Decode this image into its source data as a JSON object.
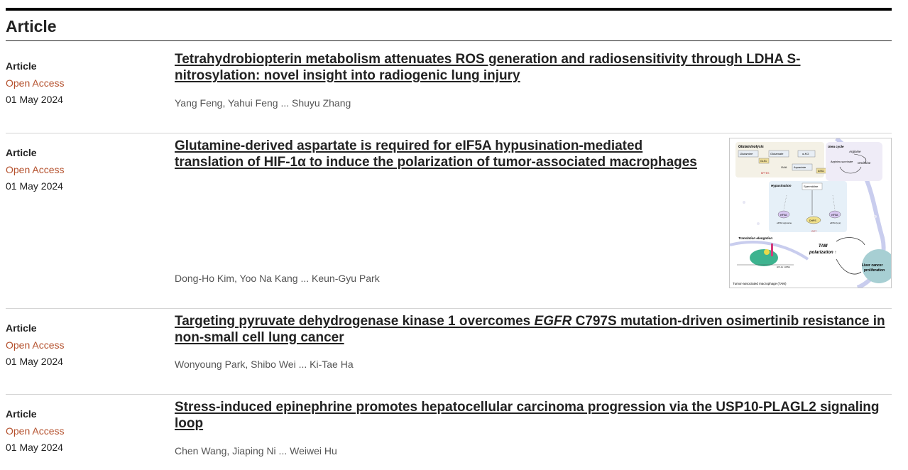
{
  "section": {
    "heading": "Article"
  },
  "articles": [
    {
      "type": "Article",
      "access": "Open Access",
      "date": "01 May 2024",
      "title_line1": "Tetrahydrobiopterin metabolism attenuates ROS generation and radiosensitivity through LDHA S-",
      "title_line2": "nitrosylation: novel insight into radiogenic lung injury",
      "authors": "Yang Feng, Yahui Feng ... Shuyu Zhang"
    },
    {
      "type": "Article",
      "access": "Open Access",
      "date": "01 May 2024",
      "title_line1": "Glutamine-derived aspartate is required for eIF5A hypusination-mediated",
      "title_line2": "translation of HIF-1α to induce the polarization of tumor-associated macrophages",
      "authors": "Dong-Ho Kim, Yoo Na Kang ... Keun-Gyu Park",
      "figure": {
        "glutaminolysis": "Glutaminolysis",
        "urea_cycle": "Urea cycle",
        "glutamine": "Glutamine",
        "glutamate": "Glutamate",
        "akg": "α-KG",
        "gls1": "GLS1",
        "oaa": "OAA",
        "aspartate": "Aspartate",
        "ass1": "ASS1",
        "bptes": "BPTES",
        "arginine": "Arginine",
        "arg_succ": "Arginino-succinate",
        "ornithine": "Ornithine",
        "hypusination": "Hypusination",
        "spermidine": "Spermidine",
        "eif5a": "eIF5A",
        "eif5a_hyp": "eIF5A Hypusine",
        "dhps": "DHPS",
        "eif5a_lys": "eIF5A (Lys)",
        "gc7": "GC7",
        "translation": "Translation elongation",
        "tam": "TAM",
        "polarization": "polarization ↑",
        "hif": "HIF-1α mRNA",
        "liver": "Liver cancer",
        "prolif": "proliferation",
        "footer": "Tumor-associated macrophage (TAM)"
      }
    },
    {
      "type": "Article",
      "access": "Open Access",
      "date": "01 May 2024",
      "title_line1_a": "Targeting pyruvate dehydrogenase kinase 1 overcomes ",
      "title_line1_em": "EGFR",
      "title_line1_b": " C797S mutation-driven osimertinib resistance in",
      "title_line2": "non-small cell lung cancer",
      "authors": "Wonyoung Park, Shibo Wei ... Ki-Tae Ha"
    },
    {
      "type": "Article",
      "access": "Open Access",
      "date": "01 May 2024",
      "title_line1": "Stress-induced epinephrine promotes hepatocellular carcinoma progression via the USP10-PLAGL2 signaling",
      "title_line2": "loop",
      "authors": "Chen Wang, Jiaping Ni ... Weiwei Hu"
    }
  ],
  "colors": {
    "open_access": "#b4502c",
    "separator": "#d5d5d5"
  }
}
